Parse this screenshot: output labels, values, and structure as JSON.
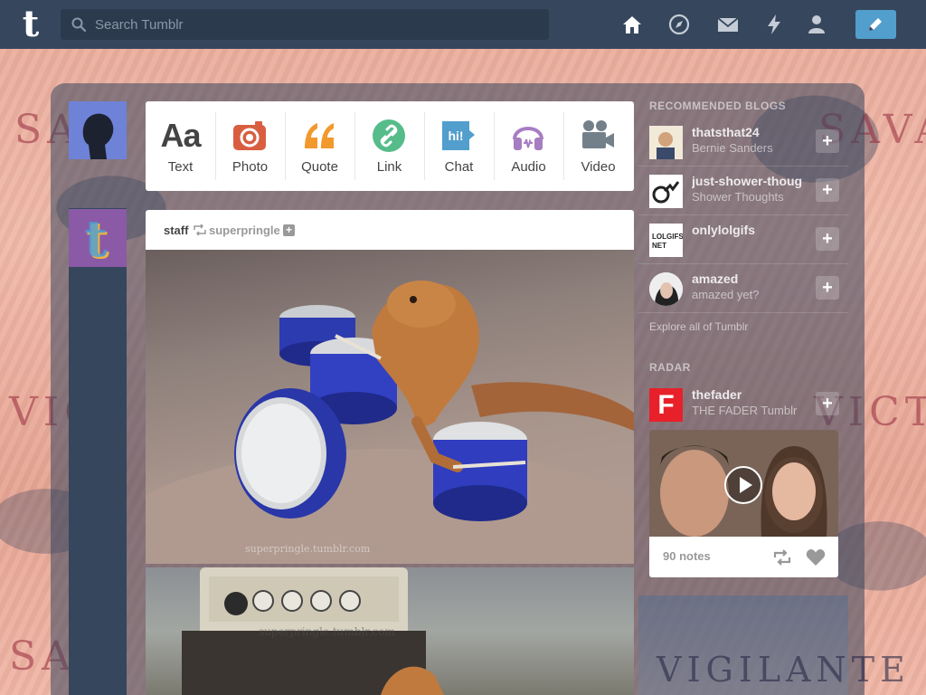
{
  "colors": {
    "topbar": "#36465d",
    "search_bg": "#2c3a4e",
    "accent_blue": "#529ecc",
    "photo_red": "#d95e40",
    "quote_orange": "#f2992e",
    "link_green": "#56bc8a",
    "chat_blue": "#529ecc",
    "audio_purple": "#a77dc2",
    "video_gray": "#748089"
  },
  "header": {
    "logo": "t",
    "search_placeholder": "Search Tumblr",
    "nav_icons": [
      "home-icon",
      "explore-compass-icon",
      "inbox-mail-icon",
      "activity-lightning-icon",
      "account-person-icon"
    ],
    "compose_icon": "pencil-icon"
  },
  "background": {
    "words": [
      "SA",
      "VIG",
      "VICT",
      "SAVA",
      "VIGILANTE",
      "SA"
    ]
  },
  "post_types": [
    {
      "label": "Text",
      "glyph": "Aa",
      "icon": "text-icon"
    },
    {
      "label": "Photo",
      "icon": "camera-icon"
    },
    {
      "label": "Quote",
      "glyph": "““",
      "icon": "quote-icon"
    },
    {
      "label": "Link",
      "icon": "link-icon"
    },
    {
      "label": "Chat",
      "glyph": "hi!",
      "icon": "chat-icon"
    },
    {
      "label": "Audio",
      "icon": "headphones-icon"
    },
    {
      "label": "Video",
      "icon": "video-camera-icon"
    }
  ],
  "post": {
    "user": "staff",
    "source": "superpringle",
    "photo1_watermark": "superpringle.tumblr.com",
    "photo2_watermark": "superpringle.tumblr.com"
  },
  "sidebar": {
    "recommended_title": "RECOMMENDED BLOGS",
    "recommended": [
      {
        "name": "thatsthat24",
        "sub": "Bernie Sanders"
      },
      {
        "name": "just-shower-thoug",
        "sub": "Shower Thoughts"
      },
      {
        "name": "onlylolgifs",
        "sub": "",
        "avatar_text": "LOLGIFS.\nNET"
      },
      {
        "name": "amazed",
        "sub": "amazed yet?"
      }
    ],
    "explore_link": "Explore all of Tumblr",
    "radar_title": "RADAR",
    "radar": {
      "name": "thefader",
      "sub": "THE FADER Tumblr",
      "avatar_letter": "F",
      "notes": "90 notes"
    }
  }
}
